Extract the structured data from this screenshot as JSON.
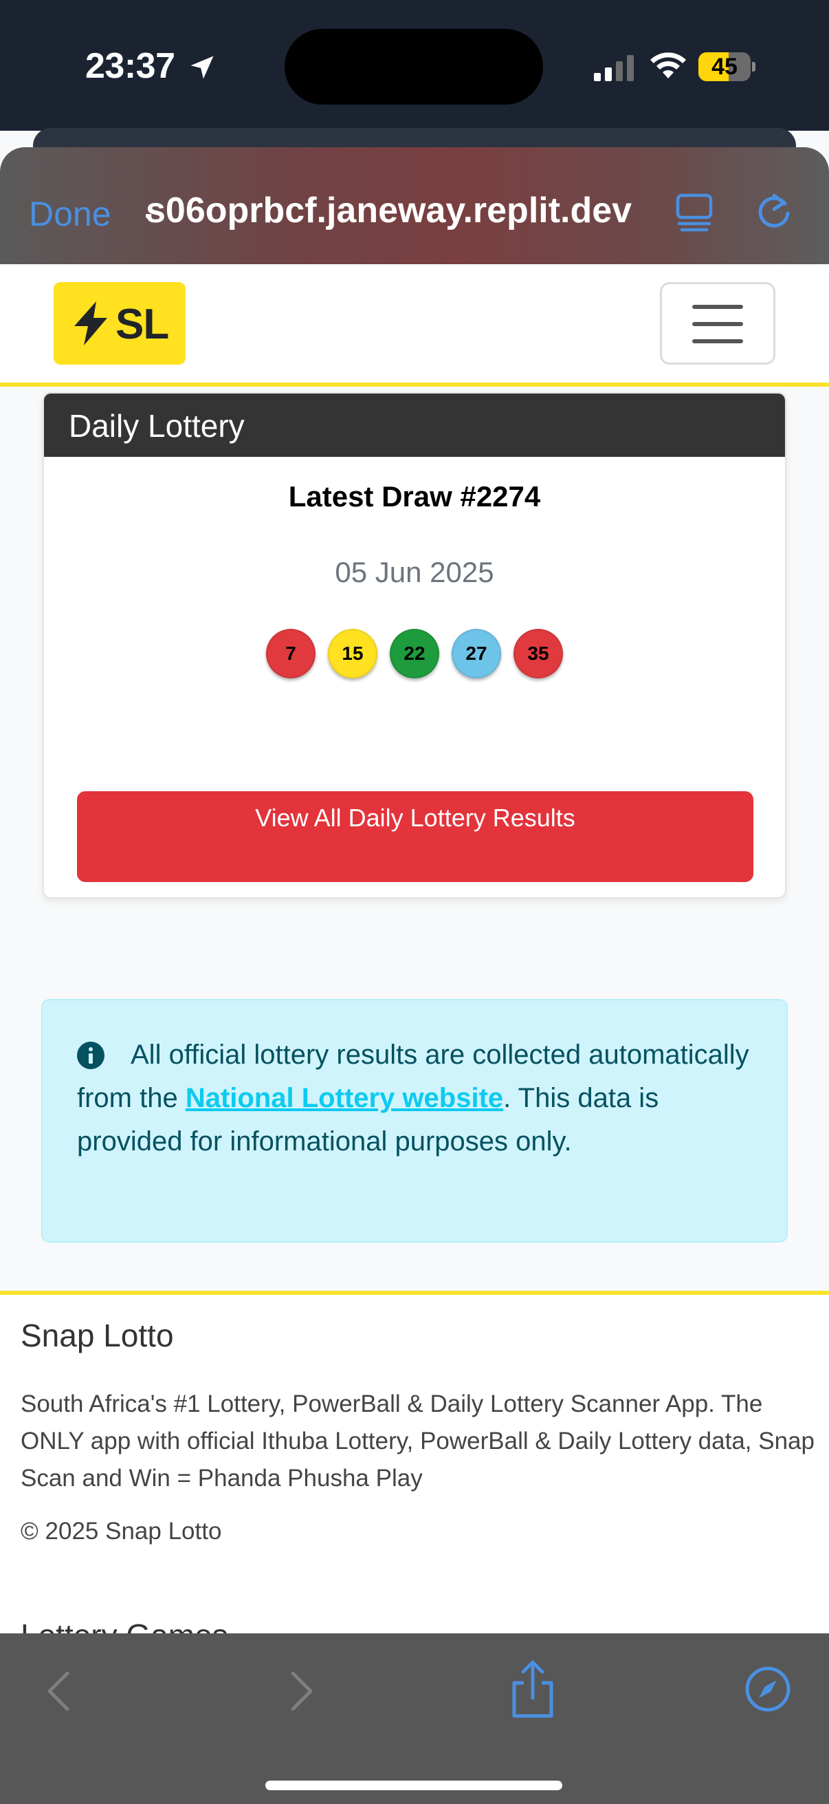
{
  "status_bar": {
    "time": "23:37",
    "battery": "45",
    "icons": [
      "location-arrow-icon",
      "cellular-signal-icon",
      "wifi-icon",
      "battery-icon"
    ]
  },
  "browser": {
    "done_label": "Done",
    "url": "̵s06oprbcf.janeway.replit.dev",
    "icons": [
      "tabs-icon",
      "reload-icon"
    ]
  },
  "navbar": {
    "brand_text": "SL",
    "brand_color": "#ffe11f",
    "icons": [
      "lightning-bolt-icon",
      "hamburger-menu-icon"
    ]
  },
  "lottery_card": {
    "title": "Daily Lottery",
    "draw_title": "Latest Draw #2274",
    "draw_date": "05 Jun 2025",
    "balls": [
      {
        "number": "7",
        "color": "#e03a3e"
      },
      {
        "number": "15",
        "color": "#ffe11f"
      },
      {
        "number": "22",
        "color": "#1e9b3c"
      },
      {
        "number": "27",
        "color": "#6ec3e8"
      },
      {
        "number": "35",
        "color": "#e03a3e"
      }
    ],
    "button_label": "View All Daily Lottery Results",
    "button_color": "#e3333b"
  },
  "info_alert": {
    "text_before": "All official lottery results are collected automatically from the ",
    "link_text": "National Lottery website",
    "text_after": ". This data is provided for informational purposes only.",
    "icon": "info-circle-icon"
  },
  "footer": {
    "title": "Snap Lotto",
    "description": "South Africa's #1 Lottery, PowerBall & Daily Lottery Scanner App. The ONLY app with official Ithuba Lottery, PowerBall & Daily Lottery data, Snap Scan and Win = Phanda Phusha Play",
    "copyright": "© 2025 Snap Lotto",
    "next_section_title": "Lottery Games",
    "accent_color": "#f8e32b"
  },
  "toolbar": {
    "icons": [
      "back-icon",
      "forward-icon",
      "share-icon",
      "compass-icon"
    ],
    "accent_color": "#4a90e2"
  }
}
